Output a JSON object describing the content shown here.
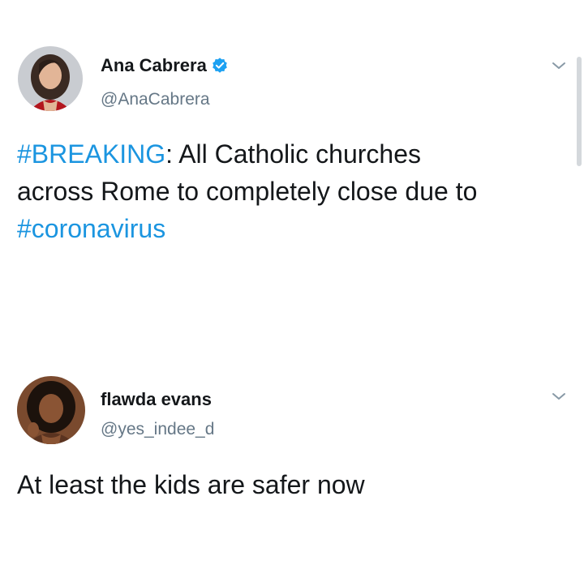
{
  "tweets": [
    {
      "author": {
        "display_name": "Ana Cabrera",
        "handle": "@AnaCabrera",
        "verified": true,
        "avatar_icon": "avatar-photo-ana-cabrera"
      },
      "text": {
        "hashtag_breaking": "#BREAKING",
        "line1_rest": ": All Catholic churches",
        "line2": "across Rome to completely close due to",
        "hashtag_coronavirus": "#coronavirus"
      }
    },
    {
      "author": {
        "display_name": "flawda evans",
        "handle": "@yes_indee_d",
        "verified": false,
        "avatar_icon": "avatar-photo-flawda-evans"
      },
      "text": {
        "body": "At least the kids are safer now"
      }
    }
  ],
  "colors": {
    "hashtag": "#1b95e0",
    "verified": "#1da1f2",
    "handle": "#657786",
    "text": "#14171a"
  },
  "icons": {
    "verified": "verified-badge-icon",
    "caret": "chevron-down-icon"
  }
}
